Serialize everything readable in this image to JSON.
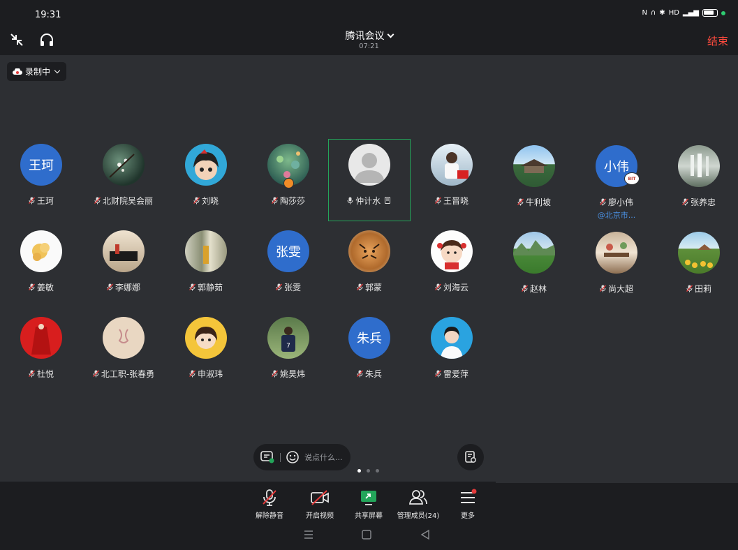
{
  "status_bar": {
    "time": "19:31"
  },
  "header": {
    "title": "腾讯会议",
    "timer": "07:21",
    "end_label": "结束"
  },
  "recording": {
    "label": "录制中"
  },
  "participants": [
    {
      "name": "王珂",
      "avatar_text": "王珂",
      "muted": true
    },
    {
      "name": "北财院吴会丽",
      "muted": true
    },
    {
      "name": "刘晓",
      "muted": true
    },
    {
      "name": "陶莎莎",
      "muted": true,
      "host": true
    },
    {
      "name": "仲计水",
      "muted": false,
      "speaking": true
    },
    {
      "name": "王晋晓",
      "muted": true
    },
    {
      "name": "牛利坡",
      "muted": true
    },
    {
      "name": "廖小伟",
      "avatar_text": "小伟",
      "muted": true,
      "subtitle": "@北京市...",
      "badge": "BIT"
    },
    {
      "name": "张养忠",
      "muted": true
    },
    {
      "name": "姜敏",
      "muted": true
    },
    {
      "name": "李娜娜",
      "muted": true
    },
    {
      "name": "郭静茹",
      "muted": true
    },
    {
      "name": "张雯",
      "avatar_text": "张雯",
      "muted": true
    },
    {
      "name": "郭蒙",
      "muted": true
    },
    {
      "name": "刘海云",
      "muted": true
    },
    {
      "name": "赵林",
      "muted": true
    },
    {
      "name": "尚大超",
      "muted": true
    },
    {
      "name": "田莉",
      "muted": true
    },
    {
      "name": "杜悦",
      "muted": true
    },
    {
      "name": "北工职-张春勇",
      "muted": true
    },
    {
      "name": "申淑玮",
      "muted": true
    },
    {
      "name": "姚昊炜",
      "muted": true
    },
    {
      "name": "朱兵",
      "avatar_text": "朱兵",
      "muted": true
    },
    {
      "name": "雷爱萍",
      "muted": true
    }
  ],
  "chat": {
    "placeholder": "说点什么..."
  },
  "toolbar": {
    "unmute_label": "解除静音",
    "video_label": "开启视频",
    "share_label": "共享屏幕",
    "members_label": "管理成员(24)",
    "more_label": "更多"
  },
  "colors": {
    "accent_green": "#23a55a",
    "end_red": "#ff4b3e",
    "avatar_blue": "#2f6dcc"
  }
}
